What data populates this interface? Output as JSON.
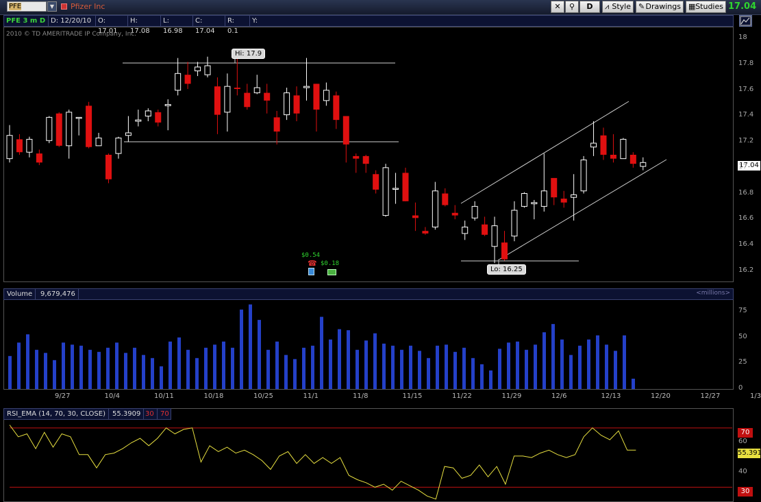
{
  "toolbar": {
    "symbol": "PFE",
    "company": "Pfizer Inc",
    "interval_button": "D",
    "style_label": "Style",
    "drawings_label": "Drawings",
    "studies_label": "Studies",
    "last_price": "17.04"
  },
  "header": {
    "symbol_period": "PFE 3 m D",
    "date": "D: 12/20/10",
    "open": "O: 17.01",
    "high": "H: 17.08",
    "low": "L: 16.98",
    "close": "C: 17.04",
    "range": "R: 0.1",
    "y": "Y:",
    "copyright": "2010 © TD AMERITRADE IP Company, Inc."
  },
  "price_panel": {
    "y_ticks": [
      "18",
      "17.8",
      "17.6",
      "17.4",
      "17.2",
      "17",
      "16.8",
      "16.6",
      "16.4",
      "16.2"
    ],
    "current_price_label": "17.04",
    "hi_label": "Hi: 17.9",
    "lo_label": "Lo: 16.25",
    "dividend_1": "$0.54",
    "dividend_2": "$0.18"
  },
  "volume_panel": {
    "title": "Volume",
    "value": "9,679,476",
    "unit_label": "<millions>",
    "y_ticks": [
      "75",
      "50",
      "25",
      "0"
    ]
  },
  "date_axis": [
    "9/27",
    "10/4",
    "10/11",
    "10/18",
    "10/25",
    "11/1",
    "11/8",
    "11/15",
    "11/22",
    "11/29",
    "12/6",
    "12/13",
    "12/20",
    "12/27",
    "1/3"
  ],
  "rsi_panel": {
    "title": "RSI_EMA (14, 70, 30, CLOSE)",
    "value": "55.3909",
    "low_level": "30",
    "high_level": "70",
    "y_ticks": [
      "60",
      "40"
    ],
    "right_70": "70",
    "right_30": "30",
    "current_label": "55.391"
  },
  "colors": {
    "up": "#ffffff",
    "down": "#e01010",
    "volume": "#2440c8",
    "rsi_line": "#e8e040",
    "level_line": "#c01010",
    "accent_green": "#2fd42f"
  },
  "chart_data": {
    "type": "candlestick",
    "price_range": [
      16.15,
      18.05
    ],
    "candles": [
      {
        "o": 17.07,
        "h": 17.33,
        "l": 17.04,
        "c": 17.25
      },
      {
        "o": 17.22,
        "h": 17.26,
        "l": 17.1,
        "c": 17.12
      },
      {
        "o": 17.12,
        "h": 17.24,
        "l": 17.08,
        "c": 17.22
      },
      {
        "o": 17.11,
        "h": 17.14,
        "l": 17.02,
        "c": 17.04
      },
      {
        "o": 17.21,
        "h": 17.4,
        "l": 17.19,
        "c": 17.39
      },
      {
        "o": 17.42,
        "h": 17.43,
        "l": 17.16,
        "c": 17.17
      },
      {
        "o": 17.17,
        "h": 17.45,
        "l": 17.07,
        "c": 17.43
      },
      {
        "o": 17.39,
        "h": 17.39,
        "l": 17.25,
        "c": 17.39
      },
      {
        "o": 17.48,
        "h": 17.51,
        "l": 17.15,
        "c": 17.16
      },
      {
        "o": 17.17,
        "h": 17.27,
        "l": 17.17,
        "c": 17.23
      },
      {
        "o": 17.1,
        "h": 17.11,
        "l": 16.88,
        "c": 16.91
      },
      {
        "o": 17.11,
        "h": 17.24,
        "l": 17.07,
        "c": 17.23
      },
      {
        "o": 17.25,
        "h": 17.4,
        "l": 17.2,
        "c": 17.27
      },
      {
        "o": 17.36,
        "h": 17.45,
        "l": 17.32,
        "c": 17.37
      },
      {
        "o": 17.4,
        "h": 17.46,
        "l": 17.36,
        "c": 17.44
      },
      {
        "o": 17.43,
        "h": 17.45,
        "l": 17.32,
        "c": 17.35
      },
      {
        "o": 17.48,
        "h": 17.53,
        "l": 17.29,
        "c": 17.49
      },
      {
        "o": 17.6,
        "h": 17.85,
        "l": 17.56,
        "c": 17.73
      },
      {
        "o": 17.72,
        "h": 17.82,
        "l": 17.61,
        "c": 17.65
      },
      {
        "o": 17.75,
        "h": 17.82,
        "l": 17.71,
        "c": 17.78
      },
      {
        "o": 17.72,
        "h": 17.86,
        "l": 17.7,
        "c": 17.79
      },
      {
        "o": 17.63,
        "h": 17.7,
        "l": 17.26,
        "c": 17.41
      },
      {
        "o": 17.43,
        "h": 17.73,
        "l": 17.28,
        "c": 17.63
      },
      {
        "o": 17.62,
        "h": 17.9,
        "l": 17.56,
        "c": 17.61
      },
      {
        "o": 17.58,
        "h": 17.65,
        "l": 17.45,
        "c": 17.47
      },
      {
        "o": 17.58,
        "h": 17.72,
        "l": 17.57,
        "c": 17.62
      },
      {
        "o": 17.58,
        "h": 17.65,
        "l": 17.42,
        "c": 17.52
      },
      {
        "o": 17.39,
        "h": 17.44,
        "l": 17.18,
        "c": 17.28
      },
      {
        "o": 17.41,
        "h": 17.62,
        "l": 17.37,
        "c": 17.58
      },
      {
        "o": 17.56,
        "h": 17.63,
        "l": 17.36,
        "c": 17.42
      },
      {
        "o": 17.62,
        "h": 17.85,
        "l": 17.52,
        "c": 17.63
      },
      {
        "o": 17.65,
        "h": 17.65,
        "l": 17.28,
        "c": 17.45
      },
      {
        "o": 17.52,
        "h": 17.66,
        "l": 17.48,
        "c": 17.6
      },
      {
        "o": 17.56,
        "h": 17.59,
        "l": 17.3,
        "c": 17.37
      },
      {
        "o": 17.4,
        "h": 17.4,
        "l": 17.04,
        "c": 17.18
      },
      {
        "o": 17.09,
        "h": 17.11,
        "l": 16.96,
        "c": 17.07
      },
      {
        "o": 17.09,
        "h": 17.1,
        "l": 16.96,
        "c": 17.03
      },
      {
        "o": 16.95,
        "h": 16.98,
        "l": 16.8,
        "c": 16.83
      },
      {
        "o": 16.63,
        "h": 17.03,
        "l": 16.62,
        "c": 17.0
      },
      {
        "o": 16.84,
        "h": 16.96,
        "l": 16.72,
        "c": 16.84
      },
      {
        "o": 16.96,
        "h": 17.0,
        "l": 16.74,
        "c": 16.74
      },
      {
        "o": 16.63,
        "h": 16.73,
        "l": 16.51,
        "c": 16.61
      },
      {
        "o": 16.51,
        "h": 16.54,
        "l": 16.48,
        "c": 16.49
      },
      {
        "o": 16.54,
        "h": 16.89,
        "l": 16.52,
        "c": 16.82
      },
      {
        "o": 16.8,
        "h": 16.84,
        "l": 16.7,
        "c": 16.71
      },
      {
        "o": 16.65,
        "h": 16.71,
        "l": 16.6,
        "c": 16.63
      },
      {
        "o": 16.49,
        "h": 16.59,
        "l": 16.44,
        "c": 16.54
      },
      {
        "o": 16.61,
        "h": 16.74,
        "l": 16.59,
        "c": 16.7
      },
      {
        "o": 16.56,
        "h": 16.62,
        "l": 16.47,
        "c": 16.48
      },
      {
        "o": 16.39,
        "h": 16.62,
        "l": 16.26,
        "c": 16.55
      },
      {
        "o": 16.42,
        "h": 16.51,
        "l": 16.28,
        "c": 16.29
      },
      {
        "o": 16.47,
        "h": 16.74,
        "l": 16.43,
        "c": 16.67
      },
      {
        "o": 16.7,
        "h": 16.81,
        "l": 16.69,
        "c": 16.8
      },
      {
        "o": 16.72,
        "h": 16.75,
        "l": 16.6,
        "c": 16.73
      },
      {
        "o": 16.7,
        "h": 17.11,
        "l": 16.66,
        "c": 16.82
      },
      {
        "o": 16.92,
        "h": 16.92,
        "l": 16.71,
        "c": 16.77
      },
      {
        "o": 16.76,
        "h": 16.82,
        "l": 16.69,
        "c": 16.73
      },
      {
        "o": 16.77,
        "h": 16.95,
        "l": 16.59,
        "c": 16.79
      },
      {
        "o": 16.82,
        "h": 17.09,
        "l": 16.8,
        "c": 17.06
      },
      {
        "o": 17.16,
        "h": 17.36,
        "l": 17.09,
        "c": 17.19
      },
      {
        "o": 17.25,
        "h": 17.31,
        "l": 17.06,
        "c": 17.1
      },
      {
        "o": 17.1,
        "h": 17.26,
        "l": 17.04,
        "c": 17.07
      },
      {
        "o": 17.07,
        "h": 17.23,
        "l": 17.07,
        "c": 17.22
      },
      {
        "o": 17.1,
        "h": 17.12,
        "l": 17.0,
        "c": 17.03
      },
      {
        "o": 17.01,
        "h": 17.08,
        "l": 16.98,
        "c": 17.04
      }
    ],
    "volume_millions": [
      32,
      45,
      53,
      38,
      35,
      28,
      45,
      43,
      42,
      38,
      36,
      40,
      45,
      35,
      40,
      33,
      30,
      22,
      46,
      50,
      38,
      30,
      40,
      43,
      46,
      40,
      77,
      82,
      67,
      38,
      46,
      33,
      29,
      40,
      42,
      70,
      48,
      58,
      57,
      38,
      47,
      54,
      44,
      42,
      38,
      42,
      37,
      30,
      42,
      43,
      36,
      40,
      30,
      24,
      18,
      39,
      45,
      46,
      38,
      43,
      55,
      63,
      48,
      33,
      42,
      48,
      52,
      43,
      37,
      52,
      10
    ],
    "volume_range": [
      0,
      85
    ],
    "rsi_values": [
      72,
      64,
      66,
      56,
      67,
      57,
      66,
      64,
      52,
      52,
      43,
      52,
      53,
      56,
      60,
      63,
      58,
      63,
      70,
      66,
      69,
      70,
      47,
      58,
      54,
      57,
      53,
      55,
      52,
      48,
      42,
      51,
      54,
      46,
      52,
      46,
      50,
      46,
      50,
      38,
      35,
      33,
      30,
      32,
      28,
      34,
      31,
      28,
      24,
      22,
      44,
      43,
      36,
      38,
      45,
      37,
      44,
      32,
      51,
      51,
      50,
      53,
      55,
      52,
      50,
      52,
      64,
      70,
      65,
      62,
      68,
      55,
      55
    ],
    "rsi_range": [
      20,
      75
    ],
    "rsi_levels": [
      30,
      70
    ]
  }
}
